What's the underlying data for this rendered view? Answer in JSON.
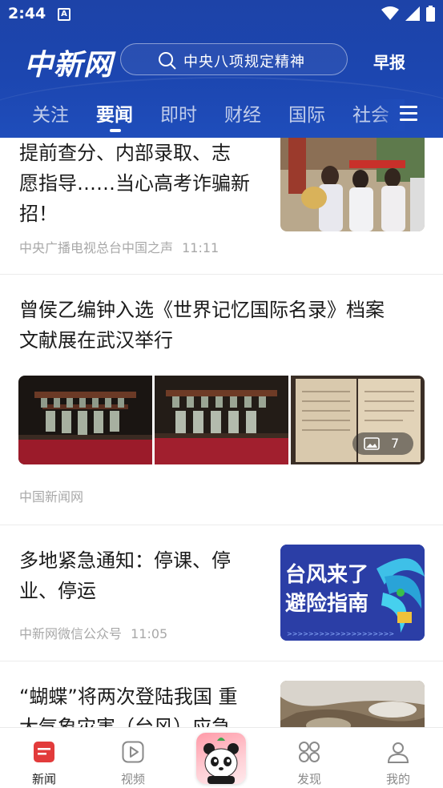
{
  "status_bar": {
    "time": "2:44",
    "notification_badge": "A"
  },
  "header": {
    "logo": "中新网",
    "search_placeholder": "中央八项规定精神",
    "morning_report": "早报",
    "colors": {
      "header_blue": "#1d43a8",
      "accent_gold": "#f7c531"
    }
  },
  "tabs": [
    "关注",
    "要闻",
    "即时",
    "财经",
    "国际",
    "社会"
  ],
  "active_tab": "要闻",
  "articles": [
    {
      "title_lines": [
        "提前查分、内部录取、志",
        "愿指导……当心高考诈骗新",
        "招！"
      ],
      "source": "中央广播电视总台中国之声",
      "time": "11:11"
    },
    {
      "title_lines": [
        "曾侯乙编钟入选《世界记忆国际名录》档案",
        "文献展在武汉举行"
      ],
      "source": "中国新闻网",
      "photo_count": "7"
    },
    {
      "title_lines": [
        "多地紧急通知：停课、停",
        "业、停运"
      ],
      "source": "中新网微信公众号",
      "time": "11:05",
      "thumb_text": [
        "台风来了",
        "避险指南"
      ]
    },
    {
      "title_lines": [
        "“蝴蝶”将两次登陆我国 重",
        "大气象灾害（台风）应急"
      ]
    }
  ],
  "bottom_nav": [
    {
      "label": "新闻",
      "icon": "news-icon",
      "active": true
    },
    {
      "label": "视频",
      "icon": "video-icon",
      "active": false
    },
    {
      "label": "",
      "icon": "panda-icon",
      "active": false
    },
    {
      "label": "发现",
      "icon": "discover-icon",
      "active": false
    },
    {
      "label": "我的",
      "icon": "profile-icon",
      "active": false
    }
  ]
}
